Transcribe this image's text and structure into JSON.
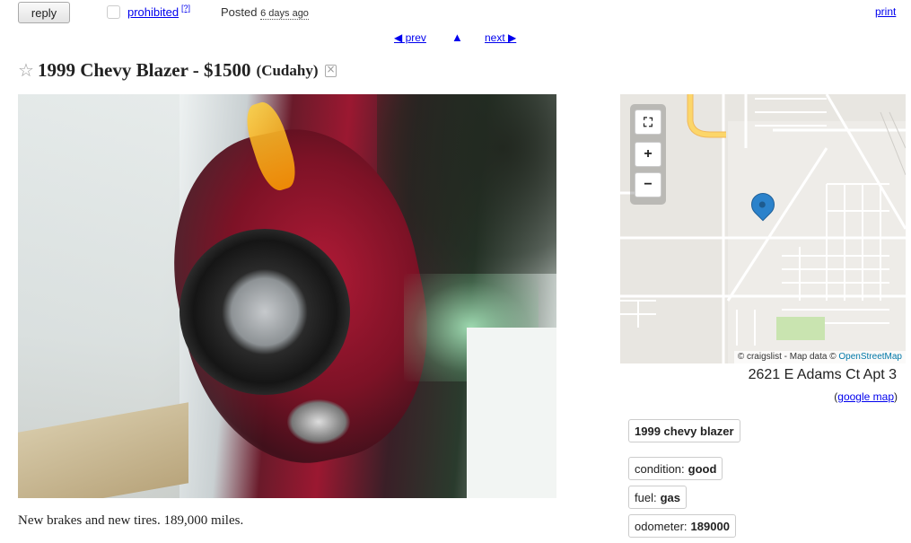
{
  "topbar": {
    "reply_label": "reply",
    "prohibited_label": "prohibited",
    "help_label": "[?]",
    "posted_label": "Posted",
    "posted_time": "6 days ago",
    "print_label": "print"
  },
  "nav": {
    "prev_label": "◀ prev",
    "up_label": "▲",
    "next_label": "next ▶"
  },
  "posting": {
    "star": "☆",
    "title": "1999 Chevy Blazer - $1500",
    "location": "(Cudahy)",
    "description": "New brakes and new tires. 189,000 miles."
  },
  "map": {
    "zoom_full_icon": "fullscreen-icon",
    "zoom_in_label": "+",
    "zoom_out_label": "−",
    "attribution_prefix": "© craigslist - Map data ©",
    "attribution_link": "OpenStreetMap",
    "address": "2621 E Adams Ct Apt 3",
    "google_map_open": "(",
    "google_map_label": "google map",
    "google_map_close": ")"
  },
  "attributes": {
    "vehicle": "1999 chevy blazer",
    "condition_label": "condition:",
    "condition_value": "good",
    "fuel_label": "fuel:",
    "fuel_value": "gas",
    "odometer_label": "odometer:",
    "odometer_value": "189000"
  },
  "colors": {
    "link": "#0000ee",
    "map_pin": "#2b82cb",
    "map_highway": "#fcd66a"
  }
}
